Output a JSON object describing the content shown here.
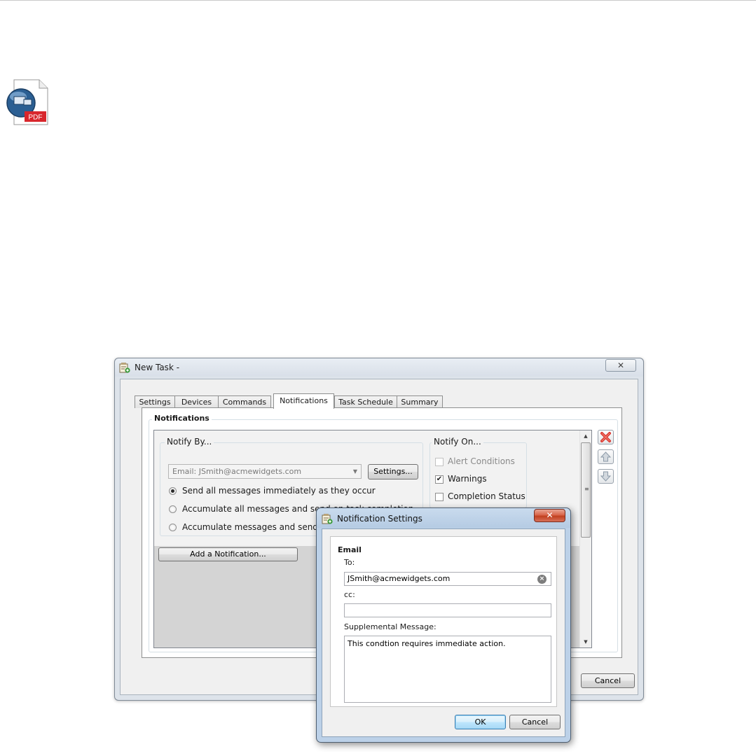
{
  "desktop": {
    "file_icon": {
      "name": "pdf-document-icon",
      "badge": "PDF"
    }
  },
  "main_window": {
    "title": "New Task -",
    "close_glyph": "✕",
    "tabs": [
      {
        "label": "Settings",
        "active": false
      },
      {
        "label": "Devices",
        "active": false
      },
      {
        "label": "Commands",
        "active": false
      },
      {
        "label": "Notifications",
        "active": true
      },
      {
        "label": "Task Schedule",
        "active": false
      },
      {
        "label": "Summary",
        "active": false
      }
    ],
    "notifications_group": {
      "title": "Notifications",
      "notify_by": {
        "title": "Notify By...",
        "combo_value": "Email: JSmith@acmewidgets.com",
        "settings_button": "Settings...",
        "options": [
          {
            "label": "Send all messages immediately as they occur",
            "checked": true
          },
          {
            "label": "Accumulate all messages and send on task completion",
            "checked": false
          },
          {
            "label": "Accumulate messages and send every",
            "checked": false
          }
        ]
      },
      "notify_on": {
        "title": "Notify On...",
        "items": [
          {
            "label": "Alert Conditions",
            "checked": false,
            "disabled": true
          },
          {
            "label": "Warnings",
            "checked": true,
            "disabled": false
          },
          {
            "label": "Completion Status",
            "checked": false,
            "disabled": false
          }
        ]
      },
      "add_button": "Add a Notification..."
    },
    "footer": {
      "cancel_button": "Cancel"
    }
  },
  "dialog": {
    "title": "Notification Settings",
    "close_glyph": "✕",
    "section_title": "Email",
    "to_label": "To:",
    "to_value": "JSmith@acmewidgets.com",
    "cc_label": "cc:",
    "cc_value": "",
    "message_label": "Supplemental Message:",
    "message_value": "This condtion requires immediate action.",
    "ok_button": "OK",
    "cancel_button": "Cancel"
  },
  "colors": {
    "delete_icon": "#d9332b",
    "arrow_icon": "#8c9aa8",
    "dialog_frame": "#bcd1e8",
    "close_red": "#c1401f"
  }
}
